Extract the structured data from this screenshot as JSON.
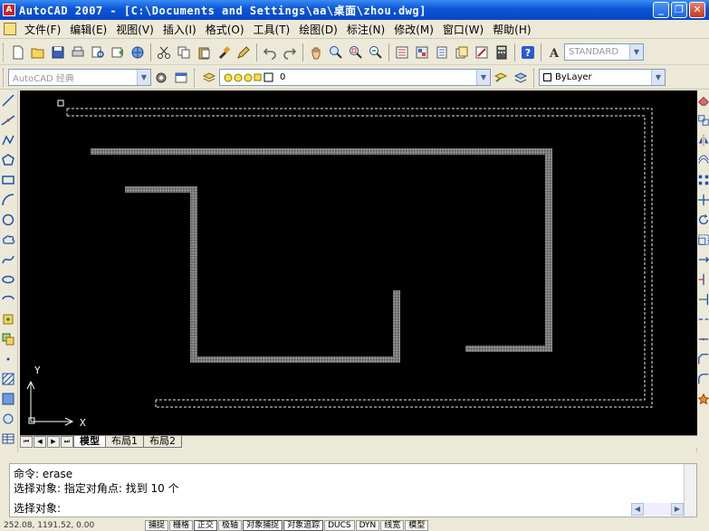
{
  "window": {
    "title": "AutoCAD 2007 - [C:\\Documents and Settings\\aa\\桌面\\zhou.dwg]",
    "app_icon": "A",
    "minimize": "_",
    "restore": "❐",
    "close": "✕"
  },
  "menu": [
    "文件(F)",
    "编辑(E)",
    "视图(V)",
    "插入(I)",
    "格式(O)",
    "工具(T)",
    "绘图(D)",
    "标注(N)",
    "修改(M)",
    "窗口(W)",
    "帮助(H)"
  ],
  "toolbar": {
    "text_style": "STANDARD",
    "workspace": "AutoCAD 经典",
    "layer_name": "0",
    "linetype": "ByLayer"
  },
  "canvas": {
    "ucs_x": "X",
    "ucs_y": "Y"
  },
  "layout_tabs": {
    "nav": [
      "⏮",
      "◀",
      "▶",
      "⏭"
    ],
    "tabs": [
      "模型",
      "布局1",
      "布局2"
    ],
    "active": "模型"
  },
  "command": {
    "line1": "命令: erase",
    "line2": "选择对象: 指定对角点: 找到 10 个",
    "prompt": "选择对象:"
  },
  "status": {
    "coords": "252.08, 1191.52, 0.00",
    "buttons": [
      "捕捉",
      "栅格",
      "正交",
      "极轴",
      "对象捕捉",
      "对象追踪",
      "DUCS",
      "DYN",
      "线宽",
      "模型"
    ]
  },
  "colors": {
    "canvas_bg": "#000000",
    "wall": "#8a8a8a",
    "selection": "#e8e8e8",
    "titlebar": "#0a55d8"
  }
}
